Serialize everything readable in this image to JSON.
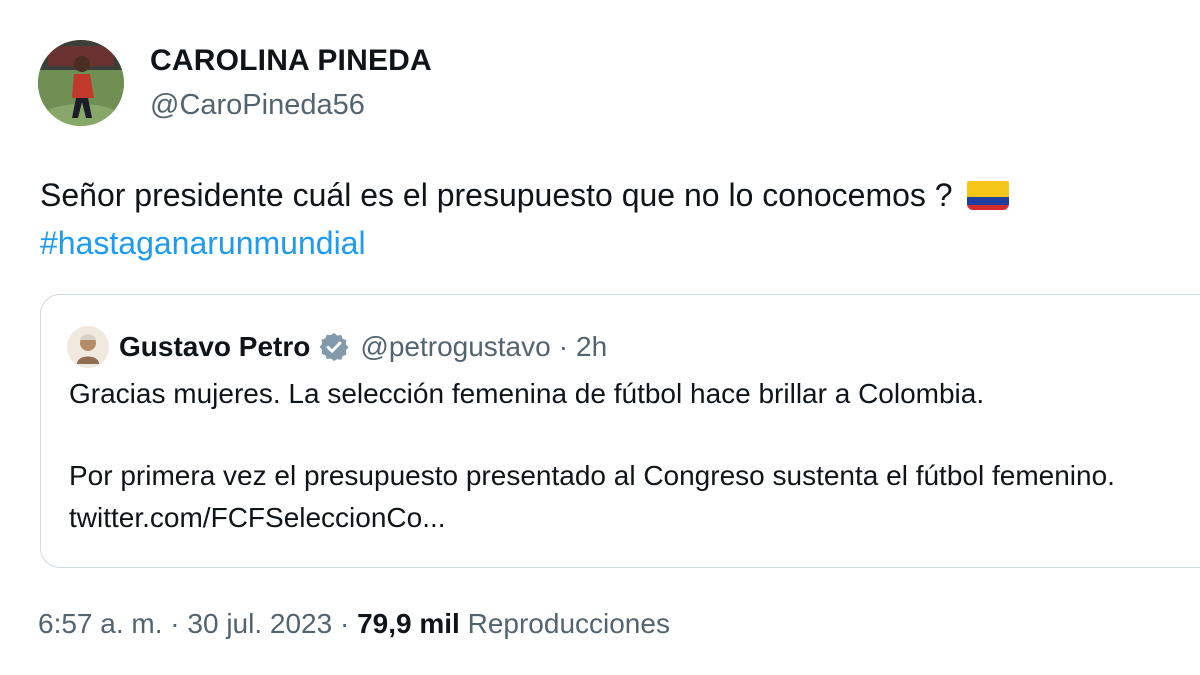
{
  "author": {
    "name": "CAROLINA PINEDA",
    "handle": "@CaroPineda56",
    "avatar": "player-photo"
  },
  "tweet": {
    "text": "Señor presidente cuál es el presupuesto que no lo conocemos ?",
    "flag": "colombia-flag-icon",
    "hashtag": "#hastaganarunmundial"
  },
  "quoted_tweet": {
    "name": "Gustavo Petro",
    "verified": "verified-badge-icon",
    "handle": "@petrogustavo",
    "separator": "·",
    "time": "2h",
    "paragraph1": "Gracias mujeres. La selección femenina de fútbol hace brillar a Colombia.",
    "paragraph2": "Por primera vez el presupuesto presentado al Congreso sustenta el fútbol femenino. twitter.com/FCFSeleccionCo..."
  },
  "meta": {
    "time": "6:57 a. m.",
    "separator": "·",
    "date": "30 jul. 2023",
    "views_count": "79,9 mil",
    "views_label": "Reproducciones"
  },
  "colors": {
    "link": "#1d9bf0",
    "secondary_text": "#536471",
    "border": "#cfd9de",
    "verified": "#829aab"
  }
}
